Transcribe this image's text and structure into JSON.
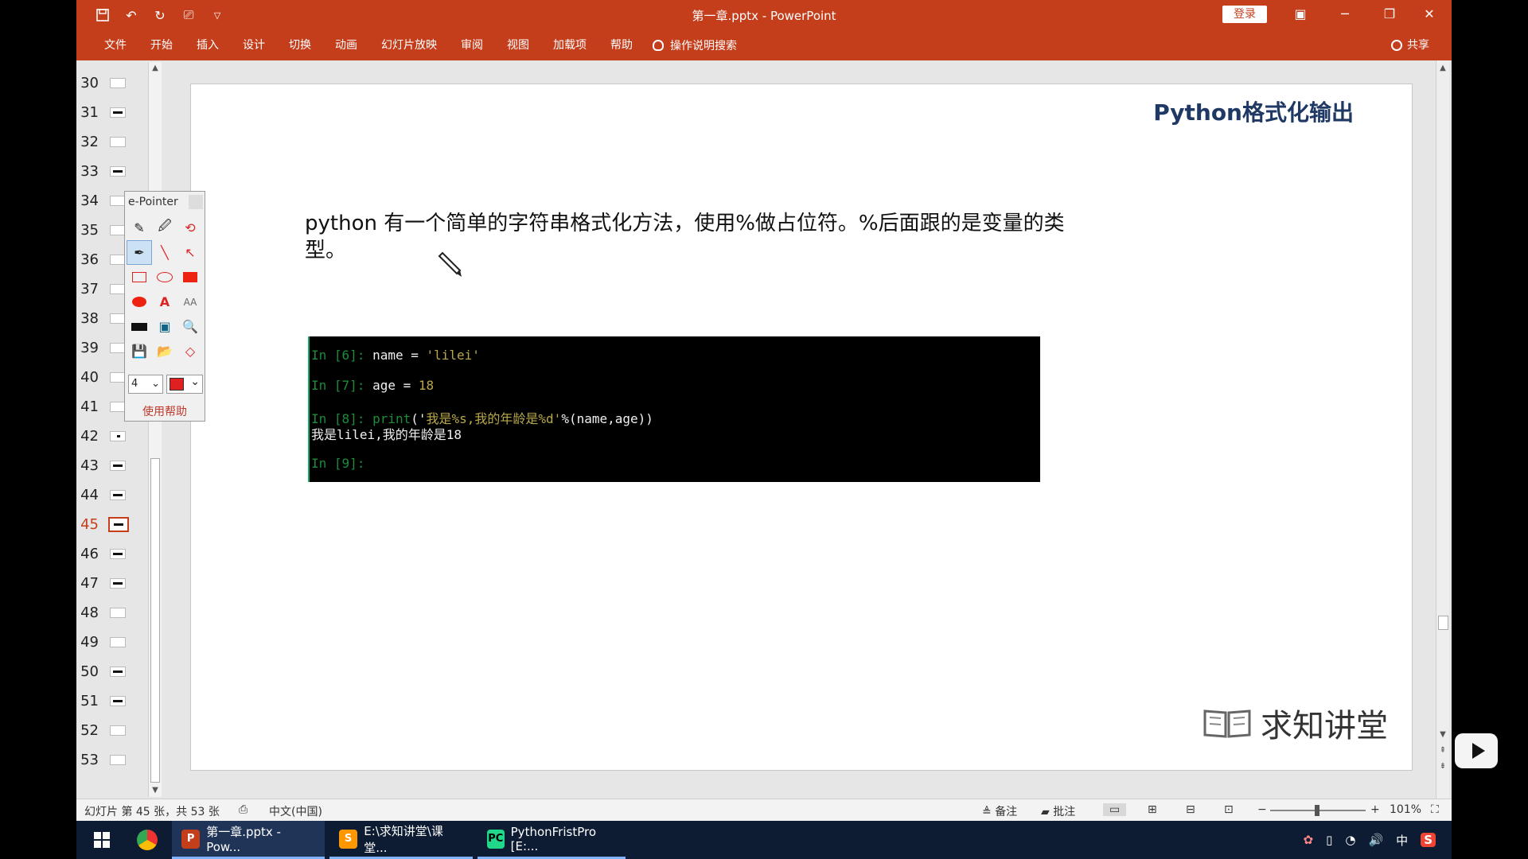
{
  "window": {
    "title": "第一章.pptx  -  PowerPoint",
    "login_label": "登录"
  },
  "ribbon": {
    "tabs": [
      "文件",
      "开始",
      "插入",
      "设计",
      "切换",
      "动画",
      "幻灯片放映",
      "审阅",
      "视图",
      "加载项",
      "帮助"
    ],
    "tell_me": "操作说明搜索",
    "share": "共享"
  },
  "thumbnails": {
    "numbers": [
      "30",
      "31",
      "32",
      "33",
      "34",
      "35",
      "36",
      "37",
      "38",
      "39",
      "40",
      "41",
      "42",
      "43",
      "44",
      "45",
      "46",
      "47",
      "48",
      "49",
      "50",
      "51",
      "52",
      "53"
    ],
    "active": "45"
  },
  "slide": {
    "title": "Python格式化输出",
    "body": "python 有一个简单的字符串格式化方法，使用%做占位符。%后面跟的是变量的类型。",
    "code": {
      "line1_prompt": "In [6]: ",
      "line1_code": "name = ",
      "line1_str": "'lilei'",
      "line2_prompt": "In [7]: ",
      "line2_code": "age = ",
      "line2_num": "18",
      "line3_prompt": "In [8]: ",
      "line3_fn": "print",
      "line3_open": "('",
      "line3_str": "我是%s,我的年龄是%d'",
      "line3_rest": "%(name,age))",
      "output": "我是lilei,我的年龄是18",
      "line5_prompt": "In [9]:"
    },
    "logo_text": "求知讲堂"
  },
  "epointer": {
    "title": "e-Pointer",
    "width_value": "4",
    "help_label": "使用帮助",
    "pen_color": "#e02020"
  },
  "statusbar": {
    "slide_info": "幻灯片 第 45 张，共 53 张",
    "language": "中文(中国)",
    "notes": "备注",
    "comments": "批注",
    "zoom": "101%"
  },
  "taskbar": {
    "items": [
      {
        "label": "第一章.pptx - Pow...",
        "icon": "P"
      },
      {
        "label": "E:\\求知讲堂\\课堂...",
        "icon": "S"
      },
      {
        "label": "PythonFristPro [E:...",
        "icon": "PC"
      }
    ],
    "ime": "中"
  }
}
